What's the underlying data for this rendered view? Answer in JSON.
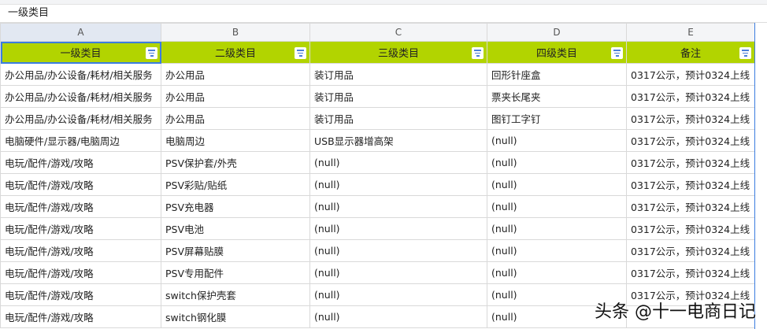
{
  "formula_bar": {
    "value": "一级类目"
  },
  "columns": [
    "A",
    "B",
    "C",
    "D",
    "E"
  ],
  "headers": [
    "一级类目",
    "二级类目",
    "三级类目",
    "四级类目",
    "备注"
  ],
  "rows": [
    [
      "办公用品/办公设备/耗材/相关服务",
      "办公用品",
      "装订用品",
      "回形针座盒",
      "0317公示，预计0324上线"
    ],
    [
      "办公用品/办公设备/耗材/相关服务",
      "办公用品",
      "装订用品",
      "票夹长尾夹",
      "0317公示，预计0324上线"
    ],
    [
      "办公用品/办公设备/耗材/相关服务",
      "办公用品",
      "装订用品",
      "图钉工字钉",
      "0317公示，预计0324上线"
    ],
    [
      "电脑硬件/显示器/电脑周边",
      "电脑周边",
      "USB显示器增高架",
      "(null)",
      "0317公示，预计0324上线"
    ],
    [
      "电玩/配件/游戏/攻略",
      "PSV保护套/外壳",
      "(null)",
      "(null)",
      "0317公示，预计0324上线"
    ],
    [
      "电玩/配件/游戏/攻略",
      "PSV彩贴/贴纸",
      "(null)",
      "(null)",
      "0317公示，预计0324上线"
    ],
    [
      "电玩/配件/游戏/攻略",
      "PSV充电器",
      "(null)",
      "(null)",
      "0317公示，预计0324上线"
    ],
    [
      "电玩/配件/游戏/攻略",
      "PSV电池",
      "(null)",
      "(null)",
      "0317公示，预计0324上线"
    ],
    [
      "电玩/配件/游戏/攻略",
      "PSV屏幕贴膜",
      "(null)",
      "(null)",
      "0317公示，预计0324上线"
    ],
    [
      "电玩/配件/游戏/攻略",
      "PSV专用配件",
      "(null)",
      "(null)",
      "0317公示，预计0324上线"
    ],
    [
      "电玩/配件/游戏/攻略",
      "switch保护壳套",
      "(null)",
      "(null)",
      "0317公示，预计0324上线"
    ],
    [
      "电玩/配件/游戏/攻略",
      "switch钢化膜",
      "(null)",
      "(null)",
      ""
    ]
  ],
  "watermark": "头条 @十一电商日记"
}
